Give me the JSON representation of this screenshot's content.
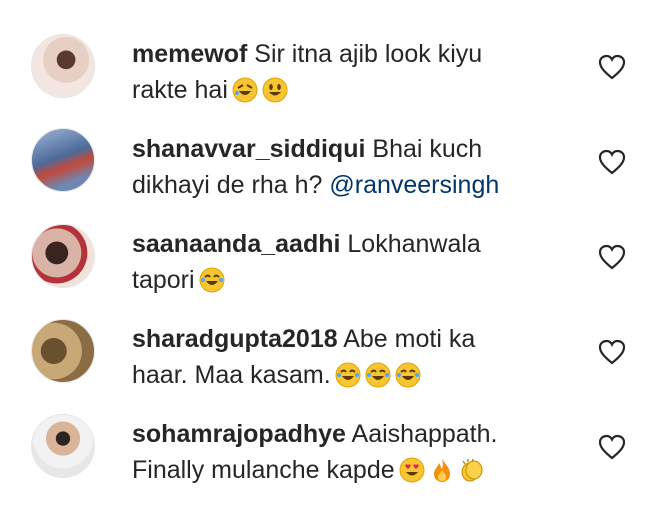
{
  "comments": [
    {
      "username": "memewof",
      "text_before": "Sir itna ajib look kiyu",
      "text_line2": "rakte hai",
      "mention": "",
      "emojis": [
        "rolling-laughing-emoji",
        "grinning-emoji"
      ]
    },
    {
      "username": "shanavvar_siddiqui",
      "text_before": "Bhai kuch",
      "text_line2": "dikhayi de rha h?",
      "mention": "@ranveersingh",
      "emojis": []
    },
    {
      "username": "saanaanda_aadhi",
      "text_before": "Lokhanwala",
      "text_line2": "tapori",
      "mention": "",
      "emojis": [
        "tears-of-joy-emoji"
      ]
    },
    {
      "username": "sharadgupta2018",
      "text_before": "Abe moti ka",
      "text_line2": "haar. Maa kasam.",
      "mention": "",
      "emojis": [
        "tears-of-joy-emoji",
        "tears-of-joy-emoji",
        "tears-of-joy-emoji"
      ]
    },
    {
      "username": "sohamrajopadhye",
      "text_before": "Aaishappath.",
      "text_line2": "Finally mulanche kapde",
      "mention": "",
      "emojis": [
        "heart-eyes-emoji",
        "fire-emoji",
        "clapping-hands-emoji"
      ]
    }
  ],
  "colors": {
    "text": "#262626",
    "mention": "#00376b",
    "emoji": "#f7c531"
  }
}
